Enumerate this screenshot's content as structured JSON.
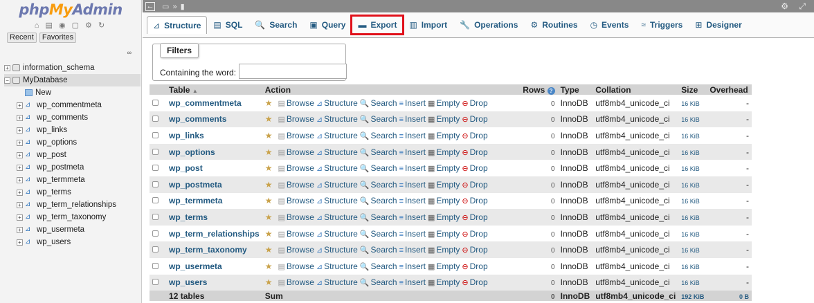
{
  "nav": {
    "logo": {
      "php": "php",
      "my": "My",
      "admin": "Admin"
    },
    "icons": "⌂ ▤ ◉ ▢ ⚙ ↻",
    "recent": "Recent",
    "favorites": "Favorites",
    "link_icon": "∞",
    "tree": [
      {
        "label": "information_schema",
        "type": "db",
        "expander": "+"
      },
      {
        "label": "MyDatabase",
        "type": "db",
        "expander": "−",
        "selected": true
      },
      {
        "label": "New",
        "type": "new"
      },
      {
        "label": "wp_commentmeta",
        "type": "table"
      },
      {
        "label": "wp_comments",
        "type": "table"
      },
      {
        "label": "wp_links",
        "type": "table"
      },
      {
        "label": "wp_options",
        "type": "table"
      },
      {
        "label": "wp_post",
        "type": "table"
      },
      {
        "label": "wp_postmeta",
        "type": "table"
      },
      {
        "label": "wp_termmeta",
        "type": "table"
      },
      {
        "label": "wp_terms",
        "type": "table"
      },
      {
        "label": "wp_term_relationships",
        "type": "table"
      },
      {
        "label": "wp_term_taxonomy",
        "type": "table"
      },
      {
        "label": "wp_usermeta",
        "type": "table"
      },
      {
        "label": "wp_users",
        "type": "table"
      }
    ]
  },
  "topbar": {
    "collapse": "←",
    "breadcrumb": "▭ » ▮",
    "right_icons": "⚙ ⤢"
  },
  "tabs": [
    {
      "label": "Structure",
      "icon": "⊿",
      "active": true
    },
    {
      "label": "SQL",
      "icon": "▤"
    },
    {
      "label": "Search",
      "icon": "🔍"
    },
    {
      "label": "Query",
      "icon": "▣"
    },
    {
      "label": "Export",
      "icon": "▬",
      "highlighted": true
    },
    {
      "label": "Import",
      "icon": "▥"
    },
    {
      "label": "Operations",
      "icon": "🔧"
    },
    {
      "label": "Routines",
      "icon": "⚙"
    },
    {
      "label": "Events",
      "icon": "◷"
    },
    {
      "label": "Triggers",
      "icon": "≈"
    },
    {
      "label": "Designer",
      "icon": "⊞"
    }
  ],
  "filters": {
    "legend": "Filters",
    "label": "Containing the word:",
    "value": ""
  },
  "table": {
    "headers": {
      "table": "Table",
      "sort": "▲",
      "action": "Action",
      "rows": "Rows",
      "rows_help": "?",
      "type": "Type",
      "collation": "Collation",
      "size": "Size",
      "overhead": "Overhead"
    },
    "actions": [
      "Browse",
      "Structure",
      "Search",
      "Insert",
      "Empty",
      "Drop"
    ],
    "rows": [
      {
        "name": "wp_commentmeta",
        "rows": "0",
        "type": "InnoDB",
        "collation": "utf8mb4_unicode_ci",
        "size": "16 KiB",
        "overhead": "-"
      },
      {
        "name": "wp_comments",
        "rows": "0",
        "type": "InnoDB",
        "collation": "utf8mb4_unicode_ci",
        "size": "16 KiB",
        "overhead": "-"
      },
      {
        "name": "wp_links",
        "rows": "0",
        "type": "InnoDB",
        "collation": "utf8mb4_unicode_ci",
        "size": "16 KiB",
        "overhead": "-"
      },
      {
        "name": "wp_options",
        "rows": "0",
        "type": "InnoDB",
        "collation": "utf8mb4_unicode_ci",
        "size": "16 KiB",
        "overhead": "-"
      },
      {
        "name": "wp_post",
        "rows": "0",
        "type": "InnoDB",
        "collation": "utf8mb4_unicode_ci",
        "size": "16 KiB",
        "overhead": "-"
      },
      {
        "name": "wp_postmeta",
        "rows": "0",
        "type": "InnoDB",
        "collation": "utf8mb4_unicode_ci",
        "size": "16 KiB",
        "overhead": "-"
      },
      {
        "name": "wp_termmeta",
        "rows": "0",
        "type": "InnoDB",
        "collation": "utf8mb4_unicode_ci",
        "size": "16 KiB",
        "overhead": "-"
      },
      {
        "name": "wp_terms",
        "rows": "0",
        "type": "InnoDB",
        "collation": "utf8mb4_unicode_ci",
        "size": "16 KiB",
        "overhead": "-"
      },
      {
        "name": "wp_term_relationships",
        "rows": "0",
        "type": "InnoDB",
        "collation": "utf8mb4_unicode_ci",
        "size": "16 KiB",
        "overhead": "-"
      },
      {
        "name": "wp_term_taxonomy",
        "rows": "0",
        "type": "InnoDB",
        "collation": "utf8mb4_unicode_ci",
        "size": "16 KiB",
        "overhead": "-"
      },
      {
        "name": "wp_usermeta",
        "rows": "0",
        "type": "InnoDB",
        "collation": "utf8mb4_unicode_ci",
        "size": "16 KiB",
        "overhead": "-"
      },
      {
        "name": "wp_users",
        "rows": "0",
        "type": "InnoDB",
        "collation": "utf8mb4_unicode_ci",
        "size": "16 KiB",
        "overhead": "-"
      }
    ],
    "footer": {
      "name": "12 tables",
      "action": "Sum",
      "rows": "0",
      "type": "InnoDB",
      "collation": "utf8mb4_unicode_ci",
      "size": "192 KiB",
      "overhead": "0 B"
    }
  },
  "colors": {
    "highlight": "#e0101a",
    "link": "#235a81"
  }
}
